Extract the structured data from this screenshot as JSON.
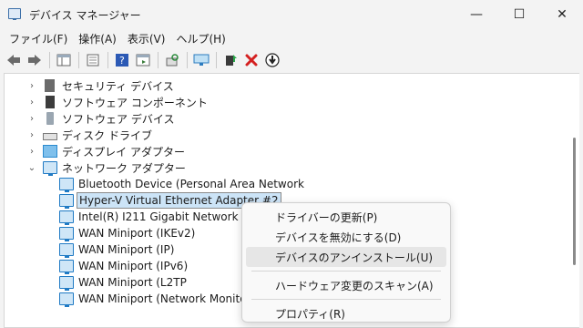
{
  "window": {
    "title": "デバイス マネージャー",
    "minimize": "—",
    "maximize": "☐",
    "close": "✕"
  },
  "menubar": [
    "ファイル(F)",
    "操作(A)",
    "表示(V)",
    "ヘルプ(H)"
  ],
  "toolbar": {
    "icons": [
      "back-icon",
      "forward-icon",
      "show-hide-tree-icon",
      "properties-icon",
      "help-icon",
      "action-pane-icon",
      "scan-hardware-icon",
      "monitor-icon",
      "update-driver-icon",
      "uninstall-icon",
      "disable-icon"
    ],
    "uninstall_color": "#d42020"
  },
  "tree": {
    "categories": [
      {
        "label": "セキュリティ デバイス",
        "expander": "›"
      },
      {
        "label": "ソフトウェア コンポーネント",
        "expander": "›"
      },
      {
        "label": "ソフトウェア デバイス",
        "expander": "›"
      },
      {
        "label": "ディスク ドライブ",
        "expander": "›"
      },
      {
        "label": "ディスプレイ アダプター",
        "expander": "›"
      },
      {
        "label": "ネットワーク アダプター",
        "expander": "⌄"
      }
    ],
    "network_devices": [
      "Bluetooth Device (Personal Area Network",
      "Hyper-V Virtual Ethernet Adapter #2",
      "Intel(R) I211 Gigabit Network Conn",
      "WAN Miniport (IKEv2)",
      "WAN Miniport (IP)",
      "WAN Miniport (IPv6)",
      "WAN Miniport (L2TP",
      "WAN Miniport (Network Monitor)"
    ]
  },
  "context_menu": {
    "items": [
      "ドライバーの更新(P)",
      "デバイスを無効にする(D)",
      "デバイスのアンインストール(U)",
      "ハードウェア変更のスキャン(A)",
      "プロパティ(R)"
    ]
  }
}
